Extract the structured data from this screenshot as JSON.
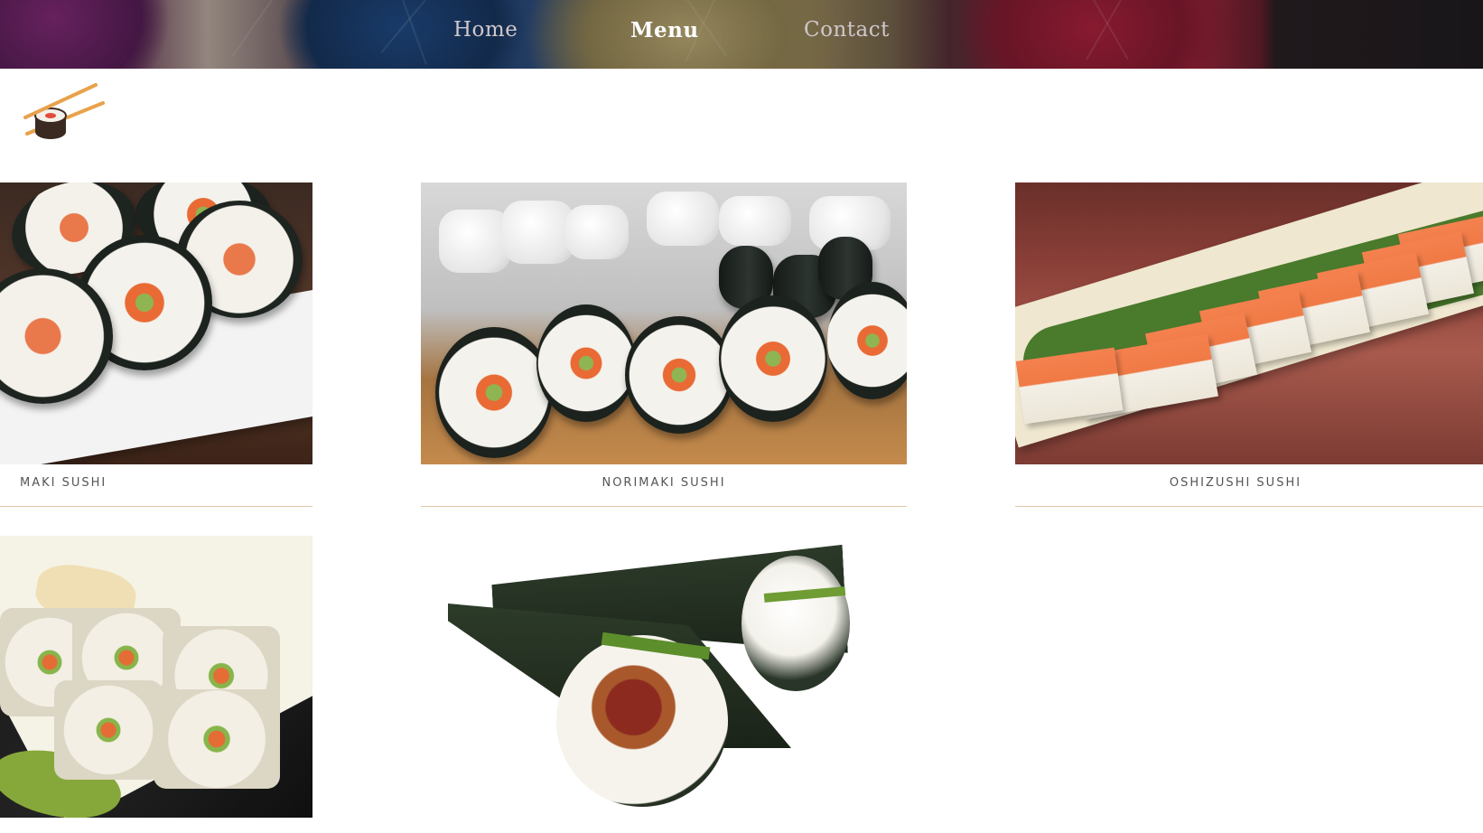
{
  "nav": {
    "home": "Home",
    "menu": "Menu",
    "contact": "Contact"
  },
  "menu_items": [
    {
      "name": "MAKI SUSHI"
    },
    {
      "name": "NORIMAKI SUSHI"
    },
    {
      "name": "OSHIZUSHI SUSHI"
    },
    {
      "name": ""
    },
    {
      "name": ""
    }
  ],
  "colors": {
    "caption": "#555555",
    "rule": "#e3c8a6",
    "nav_active": "#ffffff",
    "nav_inactive": "#cfc8cc"
  },
  "icons": {
    "logo": "sushi-roll-chopsticks-icon"
  }
}
